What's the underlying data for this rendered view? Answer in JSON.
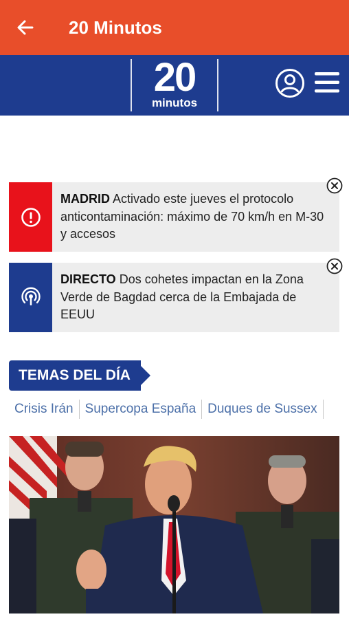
{
  "app_bar": {
    "title": "20 Minutos",
    "back_icon": "arrow-left-icon"
  },
  "brand": {
    "logo_number": "20",
    "logo_word": "minutos",
    "user_icon": "user-circle-icon",
    "menu_icon": "hamburger-menu-icon",
    "color": "#1E3C8F"
  },
  "alerts": [
    {
      "tag": "MADRID",
      "text": "Activado este jueves el protocolo anticontaminación: máximo de 70 km/h en M-30 y accesos",
      "icon": "exclamation-circle-icon",
      "color": "#E8121B"
    },
    {
      "tag": "DIRECTO",
      "text": "Dos cohetes impactan en la Zona Verde de Bagdad cerca de la Embajada de EEUU",
      "icon": "broadcast-icon",
      "color": "#1E3C8F"
    }
  ],
  "temas": {
    "label": "TEMAS DEL DÍA",
    "topics": [
      "Crisis Irán",
      "Supercopa España",
      "Duques de Sussex"
    ]
  },
  "colors": {
    "header_orange": "#E84E2A",
    "navy": "#1E3C8F",
    "alert_red": "#E8121B",
    "topic_text": "#4B6FA8"
  }
}
